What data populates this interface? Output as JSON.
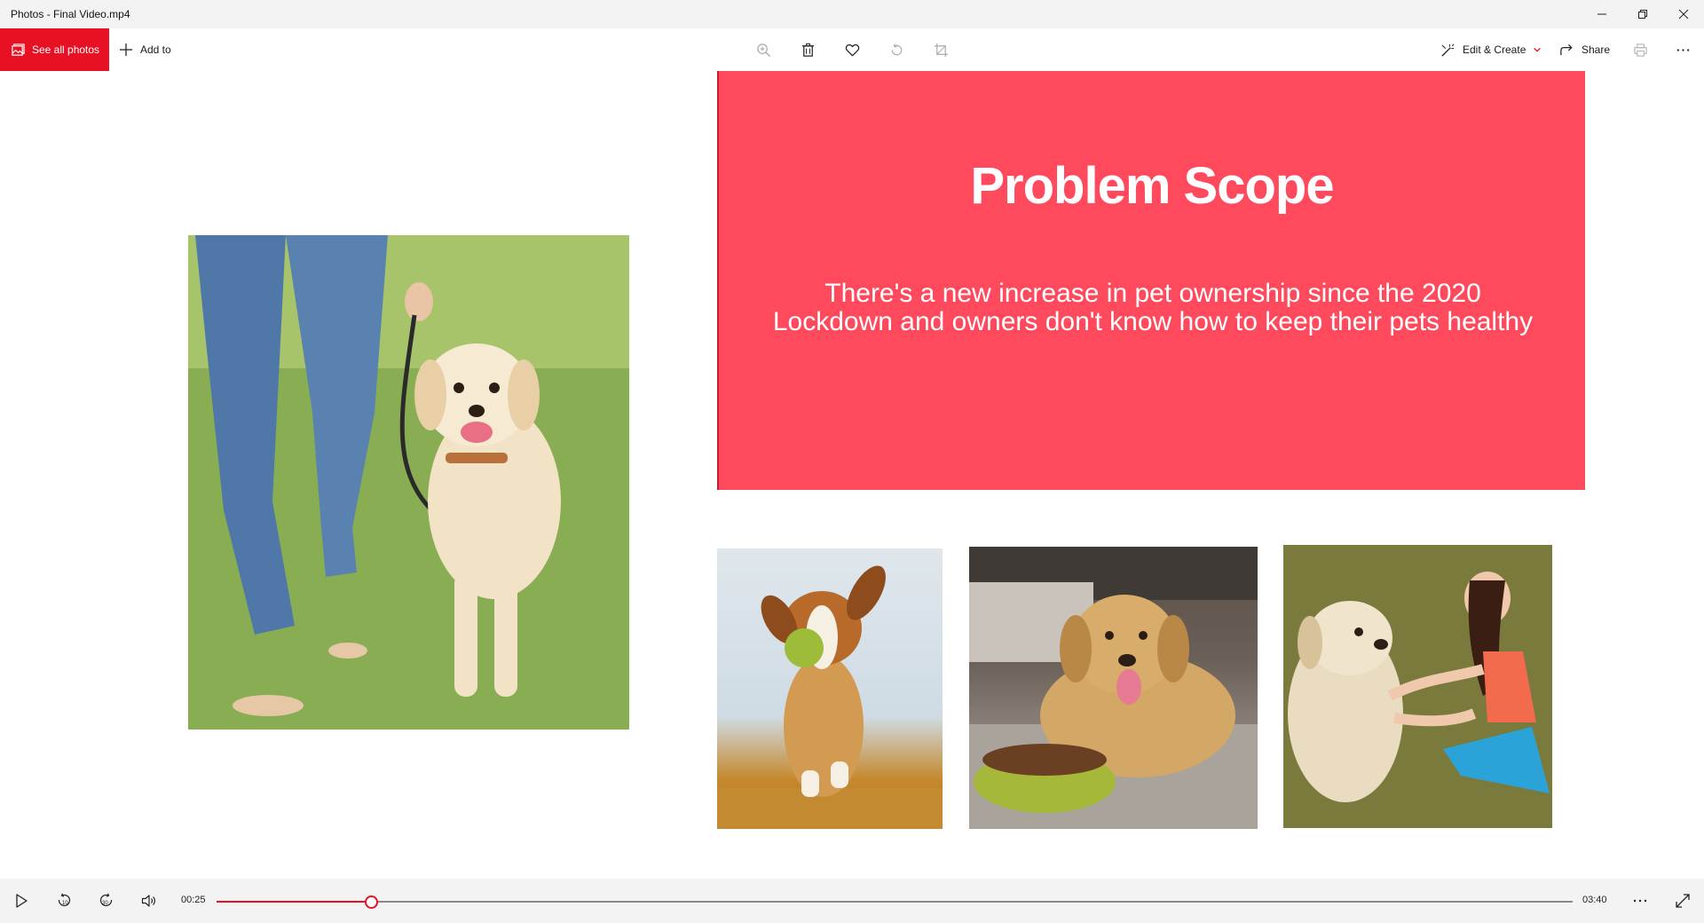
{
  "window": {
    "title": "Photos - Final Video.mp4"
  },
  "toolbar": {
    "see_all_photos": "See all photos",
    "add_to": "Add to",
    "edit_create": "Edit & Create",
    "share": "Share"
  },
  "slide": {
    "title": "Problem Scope",
    "body": "There's a new increase in pet ownership since the 2020 Lockdown and owners don't know how to keep their pets healthy"
  },
  "player": {
    "current_time": "00:25",
    "total_time": "03:40",
    "progress_fraction": 0.1136
  },
  "colors": {
    "accent": "#e81123",
    "slide_banner": "#ff4a5d"
  }
}
